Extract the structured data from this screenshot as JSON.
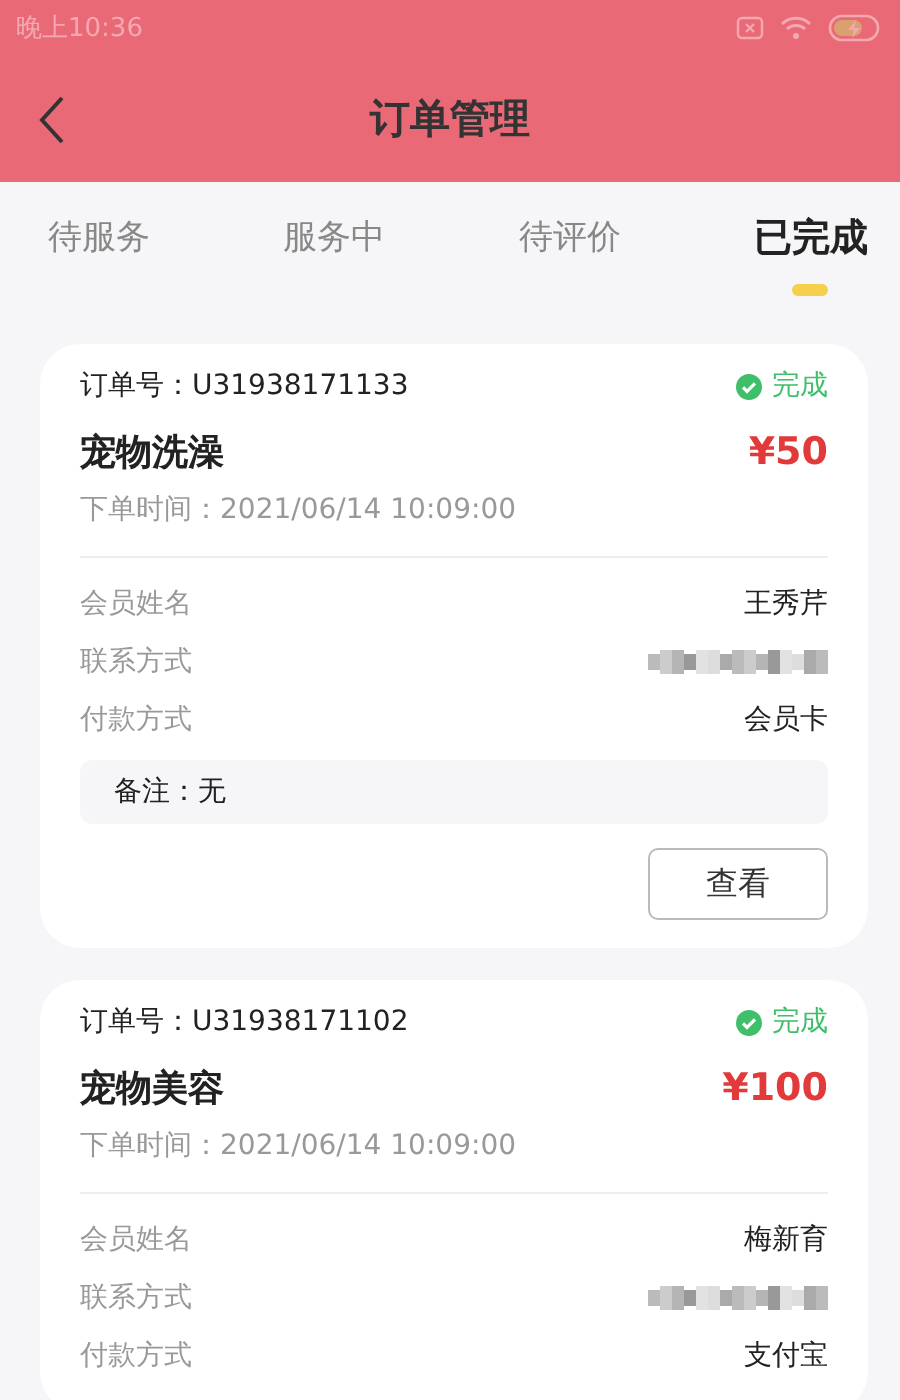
{
  "status_bar": {
    "time": "晚上10:36"
  },
  "header": {
    "title": "订单管理"
  },
  "tabs": [
    {
      "label": "待服务",
      "selected": false
    },
    {
      "label": "服务中",
      "selected": false
    },
    {
      "label": "待评价",
      "selected": false
    },
    {
      "label": "已完成",
      "selected": true
    }
  ],
  "orders": [
    {
      "order_no": "订单号：U31938171133",
      "status": "完成",
      "service": "宠物洗澡",
      "price": "¥50",
      "time": "下单时间：2021/06/14 10:09:00",
      "details": [
        {
          "kind": "text",
          "label": "会员姓名",
          "value": "王秀芹"
        },
        {
          "kind": "redacted",
          "label": "联系方式"
        },
        {
          "kind": "text",
          "label": "付款方式",
          "value": "会员卡"
        }
      ],
      "note": "备注：无",
      "button": "查看"
    },
    {
      "order_no": "订单号：U31938171102",
      "status": "完成",
      "service": "宠物美容",
      "price": "¥100",
      "time": "下单时间：2021/06/14 10:09:00",
      "details": [
        {
          "kind": "text",
          "label": "会员姓名",
          "value": "梅新育"
        },
        {
          "kind": "redacted",
          "label": "联系方式"
        },
        {
          "kind": "text",
          "label": "付款方式",
          "value": "支付宝"
        }
      ]
    }
  ]
}
